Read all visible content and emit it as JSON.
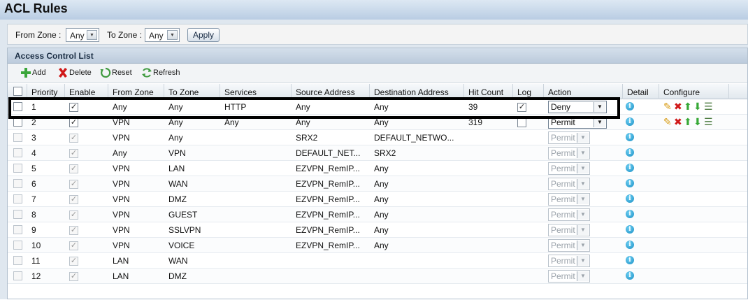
{
  "page": {
    "title": "ACL Rules"
  },
  "filter": {
    "from_label": "From Zone :",
    "from_value": "Any",
    "to_label": "To Zone :",
    "to_value": "Any",
    "apply_label": "Apply"
  },
  "panel": {
    "title": "Access Control List"
  },
  "toolbar": {
    "add": "Add",
    "delete": "Delete",
    "reset": "Reset",
    "refresh": "Refresh"
  },
  "columns": [
    "Priority",
    "Enable",
    "From Zone",
    "To Zone",
    "Services",
    "Source Address",
    "Destination Address",
    "Hit Count",
    "Log",
    "Action",
    "Detail",
    "Configure"
  ],
  "rows": [
    {
      "priority": "1",
      "enabled": true,
      "editable": true,
      "from": "Any",
      "to": "Any",
      "services": "HTTP",
      "source": "Any",
      "destination": "Any",
      "hits": "39",
      "log": true,
      "action": "Deny"
    },
    {
      "priority": "2",
      "enabled": true,
      "editable": true,
      "from": "VPN",
      "to": "Any",
      "services": "Any",
      "source": "Any",
      "destination": "Any",
      "hits": "319",
      "log": false,
      "action": "Permit"
    },
    {
      "priority": "3",
      "enabled": true,
      "editable": false,
      "from": "VPN",
      "to": "Any",
      "services": "",
      "source": "SRX2",
      "destination": "DEFAULT_NETWO...",
      "hits": "",
      "action": "Permit"
    },
    {
      "priority": "4",
      "enabled": true,
      "editable": false,
      "from": "Any",
      "to": "VPN",
      "services": "",
      "source": "DEFAULT_NET...",
      "destination": "SRX2",
      "hits": "",
      "action": "Permit"
    },
    {
      "priority": "5",
      "enabled": true,
      "editable": false,
      "from": "VPN",
      "to": "LAN",
      "services": "",
      "source": "EZVPN_RemIP...",
      "destination": "Any",
      "hits": "",
      "action": "Permit"
    },
    {
      "priority": "6",
      "enabled": true,
      "editable": false,
      "from": "VPN",
      "to": "WAN",
      "services": "",
      "source": "EZVPN_RemIP...",
      "destination": "Any",
      "hits": "",
      "action": "Permit"
    },
    {
      "priority": "7",
      "enabled": true,
      "editable": false,
      "from": "VPN",
      "to": "DMZ",
      "services": "",
      "source": "EZVPN_RemIP...",
      "destination": "Any",
      "hits": "",
      "action": "Permit"
    },
    {
      "priority": "8",
      "enabled": true,
      "editable": false,
      "from": "VPN",
      "to": "GUEST",
      "services": "",
      "source": "EZVPN_RemIP...",
      "destination": "Any",
      "hits": "",
      "action": "Permit"
    },
    {
      "priority": "9",
      "enabled": true,
      "editable": false,
      "from": "VPN",
      "to": "SSLVPN",
      "services": "",
      "source": "EZVPN_RemIP...",
      "destination": "Any",
      "hits": "",
      "action": "Permit"
    },
    {
      "priority": "10",
      "enabled": true,
      "editable": false,
      "from": "VPN",
      "to": "VOICE",
      "services": "",
      "source": "EZVPN_RemIP...",
      "destination": "Any",
      "hits": "",
      "action": "Permit"
    },
    {
      "priority": "11",
      "enabled": true,
      "editable": false,
      "from": "LAN",
      "to": "WAN",
      "services": "",
      "source": "",
      "destination": "",
      "hits": "",
      "action": "Permit"
    },
    {
      "priority": "12",
      "enabled": true,
      "editable": false,
      "from": "LAN",
      "to": "DMZ",
      "services": "",
      "source": "",
      "destination": "",
      "hits": "",
      "action": "Permit"
    }
  ],
  "icons": {
    "info": "info-icon",
    "edit": "pencil-icon",
    "delete": "delete-x-icon",
    "move_up": "arrow-up-icon",
    "move_down": "arrow-down-icon",
    "insert": "insert-rule-icon"
  },
  "colors": {
    "accent": "#1a8fc4",
    "delete": "#d01818",
    "add": "#2e9e2e",
    "highlight": "#000000"
  }
}
